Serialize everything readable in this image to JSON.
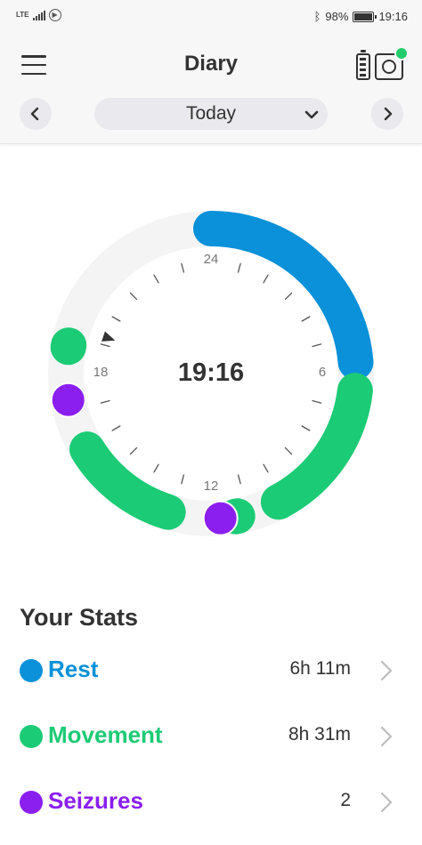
{
  "status_bar": {
    "network": "LTE",
    "data_icon": "data-saver-icon",
    "bluetooth_icon": "bluetooth-icon",
    "battery_percent": "98%",
    "battery_level": 0.98,
    "time": "19:16"
  },
  "header": {
    "title": "Diary",
    "menu_icon": "hamburger-menu-icon",
    "device_icon": "device-battery-camera-icon",
    "device_status_color": "#22cc6a",
    "date_label": "Today",
    "prev_icon": "chevron-left-icon",
    "next_icon": "chevron-right-icon",
    "dropdown_icon": "chevron-down-icon"
  },
  "clock": {
    "time": "19:16",
    "hour_labels": {
      "top": "24",
      "right": "6",
      "bottom": "12",
      "left": "18"
    },
    "colors": {
      "rest": "#0a91d9",
      "movement": "#1ccb75",
      "seizures": "#8b1ff0",
      "track": "#f4f4f5"
    },
    "rest_segments": [
      {
        "start_hour": 0.0,
        "end_hour": 5.7
      }
    ],
    "movement_segments": [
      {
        "start_hour": 6.45,
        "end_hour": 10.15
      },
      {
        "start_hour": 11.3,
        "end_hour": 11.35
      },
      {
        "start_hour": 13.15,
        "end_hour": 15.9
      },
      {
        "start_hour": 18.7,
        "end_hour": 18.75
      }
    ],
    "seizure_events": [
      {
        "hour": 11.75
      },
      {
        "hour": 17.3
      }
    ],
    "current_hour": 19.27
  },
  "stats": {
    "title": "Your Stats",
    "items": [
      {
        "label": "Rest",
        "value": "6h 11m",
        "color": "#0a91d9"
      },
      {
        "label": "Movement",
        "value": "8h 31m",
        "color": "#1ccb75"
      },
      {
        "label": "Seizures",
        "value": "2",
        "color": "#8b1ff0"
      }
    ],
    "chevron_icon": "chevron-right-icon"
  }
}
